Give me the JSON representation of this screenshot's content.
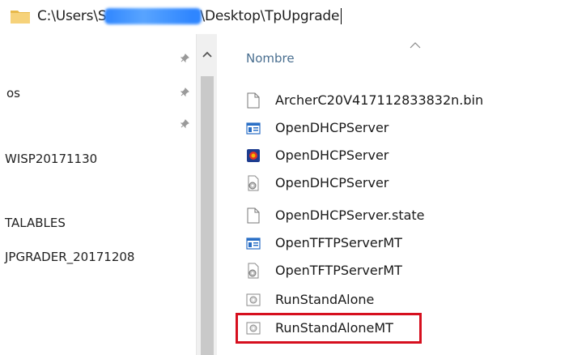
{
  "address_bar": {
    "path_start": "C:\\Users\\S",
    "path_end": "\\Desktop\\TpUpgrade",
    "redaction_color": "#2f86ff"
  },
  "left_pane": {
    "items": [
      {
        "label": "os"
      },
      {
        "label": "WISP20171130"
      },
      {
        "label": "TALABLES"
      },
      {
        "label": "JPGRADER_20171208"
      }
    ]
  },
  "right_pane": {
    "column_header": "Nombre",
    "files": [
      {
        "name": "ArcherC20V417112833832n.bin",
        "icon": "blank-file-icon"
      },
      {
        "name": "OpenDHCPServer",
        "icon": "window-app-icon"
      },
      {
        "name": "OpenDHCPServer",
        "icon": "colored-app-icon"
      },
      {
        "name": "OpenDHCPServer",
        "icon": "config-file-icon"
      },
      {
        "name": "OpenDHCPServer.state",
        "icon": "blank-file-icon"
      },
      {
        "name": "OpenTFTPServerMT",
        "icon": "window-app-icon"
      },
      {
        "name": "OpenTFTPServerMT",
        "icon": "config-file-icon"
      },
      {
        "name": "RunStandAlone",
        "icon": "batch-file-icon"
      },
      {
        "name": "RunStandAloneMT",
        "icon": "batch-file-icon"
      }
    ],
    "highlight_color": "#d60f1e"
  }
}
